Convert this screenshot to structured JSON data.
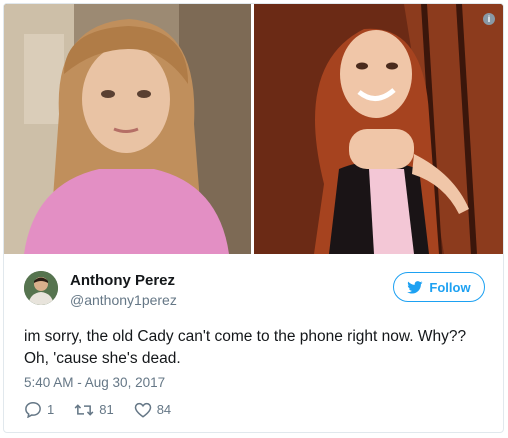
{
  "user": {
    "name": "Anthony Perez",
    "handle": "@anthony1perez"
  },
  "follow_button": {
    "label": "Follow"
  },
  "tweet": {
    "text": "im sorry, the old Cady can't come to the phone right now. Why?? Oh, 'cause she's dead.",
    "timestamp": "5:40 AM - Aug 30, 2017"
  },
  "actions": {
    "replies": "1",
    "retweets": "81",
    "likes": "84"
  },
  "media": {
    "info_glyph": "i"
  },
  "colors": {
    "brand": "#1da1f2",
    "secondary_text": "#657786",
    "border": "#e1e8ed"
  }
}
